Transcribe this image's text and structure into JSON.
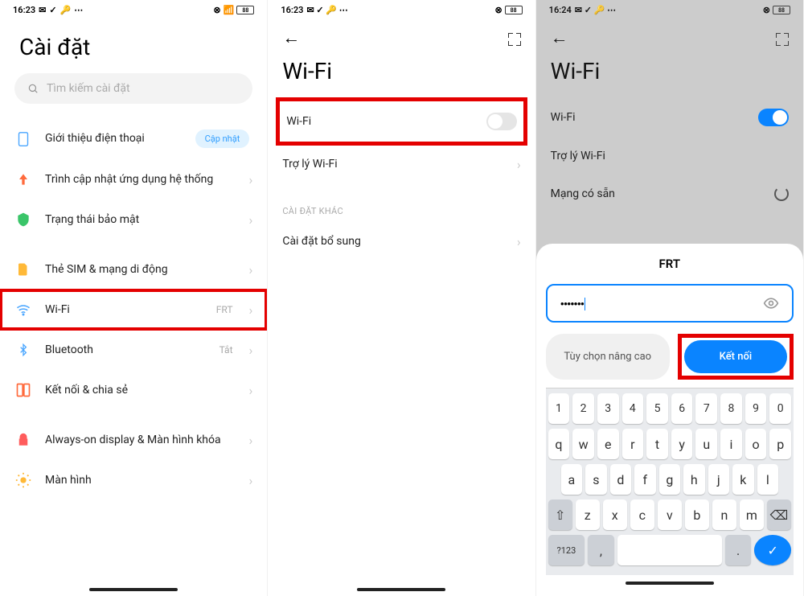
{
  "panel1": {
    "time": "16:23",
    "battery": "88",
    "title": "Cài đặt",
    "search_placeholder": "Tìm kiếm cài đặt",
    "items": {
      "about": "Giới thiệu điện thoại",
      "about_badge": "Cập nhật",
      "system_update": "Trình cập nhật ứng dụng hệ thống",
      "security": "Trạng thái bảo mật",
      "sim": "Thẻ SIM & mạng di động",
      "wifi": "Wi-Fi",
      "wifi_value": "FRT",
      "bluetooth": "Bluetooth",
      "bluetooth_value": "Tắt",
      "share": "Kết nối & chia sẻ",
      "aod": "Always-on display & Màn hình khóa",
      "display": "Màn hình"
    }
  },
  "panel2": {
    "time": "16:23",
    "battery": "88",
    "title": "Wi-Fi",
    "wifi_toggle": "Wi-Fi",
    "wifi_assistant": "Trợ lý Wi-Fi",
    "other_settings_header": "CÀI ĐẶT KHÁC",
    "additional_settings": "Cài đặt bổ sung"
  },
  "panel3": {
    "time": "16:24",
    "battery": "88",
    "title": "Wi-Fi",
    "wifi_toggle": "Wi-Fi",
    "wifi_assistant": "Trợ lý Wi-Fi",
    "available_networks": "Mạng có sẵn",
    "network_name": "FRT",
    "password_mask": "•••••••",
    "advanced_btn": "Tùy chọn nâng cao",
    "connect_btn": "Kết nối",
    "keyboard": {
      "row1": [
        "1",
        "2",
        "3",
        "4",
        "5",
        "6",
        "7",
        "8",
        "9",
        "0"
      ],
      "row2": [
        "q",
        "w",
        "e",
        "r",
        "t",
        "y",
        "u",
        "i",
        "o",
        "p"
      ],
      "row3": [
        "a",
        "s",
        "d",
        "f",
        "g",
        "h",
        "j",
        "k",
        "l"
      ],
      "row4": [
        "z",
        "x",
        "c",
        "v",
        "b",
        "n",
        "m"
      ],
      "symbols": "?123"
    }
  }
}
